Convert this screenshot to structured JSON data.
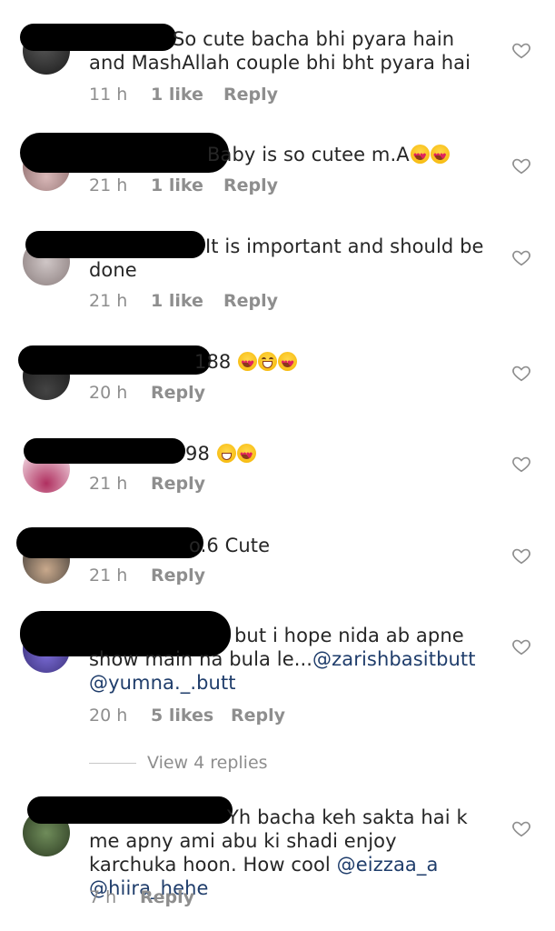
{
  "heart_icon": "heart-outline-icon",
  "colors": {
    "meta": "#8e8e8e",
    "mention": "#1f3d6b",
    "text": "#262626"
  },
  "comments": [
    {
      "text": "So cute bacha bhi pyara hain and MashAllah couple bhi bht pyara hai",
      "time": "11 h",
      "likes": "1 like",
      "reply": "Reply"
    },
    {
      "text": "Baby is so cutee m.A",
      "time": "21 h",
      "likes": "1 like",
      "reply": "Reply"
    },
    {
      "text": "It is important and should be done",
      "time": "21 h",
      "likes": "1 like",
      "reply": "Reply"
    },
    {
      "text": "188",
      "time": "20 h",
      "likes": "",
      "reply": "Reply"
    },
    {
      "text": "98",
      "time": "21 h",
      "likes": "",
      "reply": "Reply"
    },
    {
      "text": "o.6 Cute",
      "time": "21 h",
      "likes": "",
      "reply": "Reply"
    },
    {
      "text_prefix": "but i hope nida ab apne show main na bula le...",
      "mention1": "@zarishbasitbutt",
      "mention2": "@yumna._.butt",
      "time": "20 h",
      "likes": "5 likes",
      "reply": "Reply"
    },
    {
      "text_prefix": "Yh bacha keh sakta hai k me apny ami abu ki shadi enjoy karchuka hoon. How cool ",
      "mention1": "@eizzaa_a",
      "mention2": "@hiira_hehe",
      "time": "7 h",
      "likes": "",
      "reply": "Reply"
    }
  ],
  "view_replies": "View 4 replies"
}
